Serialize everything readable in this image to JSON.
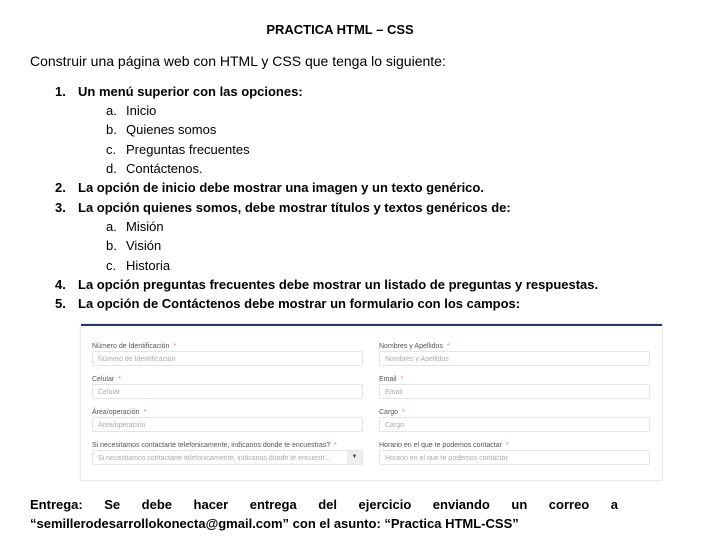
{
  "title": "PRACTICA HTML – CSS",
  "intro": "Construir una página web con HTML y CSS que tenga lo siguiente:",
  "items": [
    {
      "num": "1.",
      "text": "Un menú superior con las opciones:",
      "sub": [
        {
          "num": "a.",
          "text": "Inicio"
        },
        {
          "num": "b.",
          "text": "Quienes somos"
        },
        {
          "num": "c.",
          "text": "Preguntas frecuentes"
        },
        {
          "num": "d.",
          "text": "Contáctenos."
        }
      ]
    },
    {
      "num": "2.",
      "text": "La opción de inicio debe mostrar una imagen y un texto genérico."
    },
    {
      "num": "3.",
      "text": "La opción quienes somos, debe mostrar títulos y textos genéricos de:",
      "sub": [
        {
          "num": "a.",
          "text": "Misión"
        },
        {
          "num": "b.",
          "text": "Visión"
        },
        {
          "num": "c.",
          "text": "Historia"
        }
      ]
    },
    {
      "num": "4.",
      "text": "La opción preguntas frecuentes debe mostrar un listado de preguntas y respuestas."
    },
    {
      "num": "5.",
      "text": "La opción de Contáctenos debe mostrar un formulario con los campos:"
    }
  ],
  "form": {
    "required_mark": "*",
    "fields": [
      {
        "label": "Número de Identificación",
        "placeholder": "Número de Identificación"
      },
      {
        "label": "Nombres y Apellidos",
        "placeholder": "Nombres y Apellidos"
      },
      {
        "label": "Celular",
        "placeholder": "Celular"
      },
      {
        "label": "Email",
        "placeholder": "Email"
      },
      {
        "label": "Área/operación",
        "placeholder": "Área/operación"
      },
      {
        "label": "Cargo",
        "placeholder": "Cargo"
      },
      {
        "label": "Si necesitamos contactarte telefonicamente, indicanos donde te encuestras?",
        "placeholder": "Si necesitamos contactarte telefonicamente, indicanos donde te encuestr..."
      },
      {
        "label": "Horario en el que te podemos contactar",
        "placeholder": "Horario en el que te podemos contactar"
      }
    ],
    "dropdown_arrow": "▼"
  },
  "delivery": {
    "line1": "Entrega: Se debe hacer entrega del ejercicio enviando un correo a",
    "line2": "“semillerodesarrollokonecta@gmail.com” con el asunto: “Practica HTML-CSS”"
  }
}
